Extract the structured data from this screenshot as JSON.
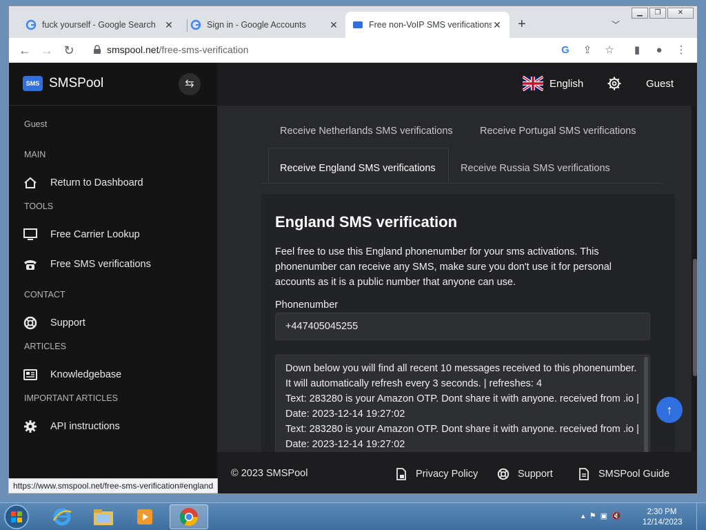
{
  "browser": {
    "tabs": [
      {
        "title": "fuck yourself - Google Search",
        "favicon": "google-icon",
        "active": false
      },
      {
        "title": "Sign in - Google Accounts",
        "favicon": "google-icon",
        "active": false
      },
      {
        "title": "Free non-VoIP SMS verifications",
        "favicon": "smspool-icon",
        "active": true
      }
    ],
    "address": {
      "host": "smspool.net",
      "path": "/free-sms-verification"
    },
    "status_url": "https://www.smspool.net/free-sms-verification#england"
  },
  "sidebar": {
    "brand": "SMSPool",
    "brand_badge": "SMS",
    "user": "Guest",
    "sections": {
      "main": "MAIN",
      "tools": "TOOLS",
      "contact": "CONTACT",
      "articles": "ARTICLES",
      "important": "IMPORTANT ARTICLES"
    },
    "items": {
      "dashboard": "Return to Dashboard",
      "carrier": "Free Carrier Lookup",
      "sms": "Free SMS verifications",
      "support": "Support",
      "kb": "Knowledgebase",
      "api": "API instructions"
    }
  },
  "topbar": {
    "language": "English",
    "user": "Guest"
  },
  "content": {
    "tabs": {
      "netherlands": "Receive Netherlands SMS verifications",
      "portugal": "Receive Portugal SMS verifications",
      "england": "Receive England SMS verifications",
      "russia": "Receive Russia SMS verifications"
    },
    "heading": "England SMS verification",
    "description": "Feel free to use this England phonenumber for your sms activations. This phonenumber can receive any SMS, make sure you don't use it for personal accounts as it is a public number that anyone can use.",
    "phone_label": "Phonenumber",
    "phone_value": "+447405045255",
    "messages_intro": "Down below you will find all recent 10 messages received to this phonenumber. It will automatically refresh every 3 seconds. | refreshes: 4",
    "messages": [
      "Text: 283280 is your Amazon OTP. Dont share it with anyone. received from .io | Date: 2023-12-14 19:27:02",
      "Text: 283280 is your Amazon OTP. Dont share it with anyone. received from .io | Date: 2023-12-14 19:27:02"
    ]
  },
  "footer": {
    "copyright": "© 2023 SMSPool",
    "privacy": "Privacy Policy",
    "support": "Support",
    "guide": "SMSPool Guide"
  },
  "taskbar": {
    "time": "2:30 PM",
    "date": "12/14/2023"
  },
  "colors": {
    "accent": "#2f6fe0",
    "sidebar_bg": "#141414",
    "page_bg": "#28292d"
  }
}
